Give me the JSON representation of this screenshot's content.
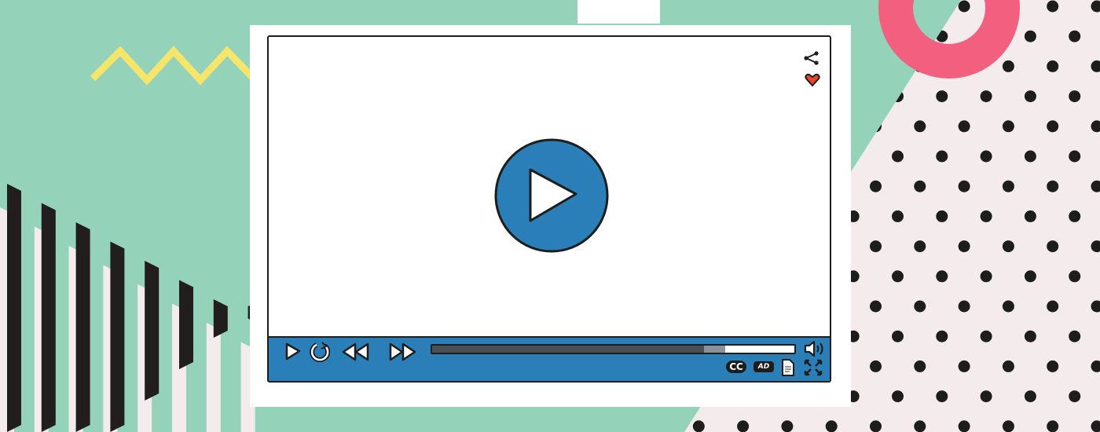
{
  "colors": {
    "background_green": "#94d3b9",
    "pattern_pink": "#f4ecec",
    "ring_pink": "#f25f7f",
    "zigzag_yellow": "#f5e56b",
    "player_blue": "#2b7fb8",
    "heart_red": "#e8452c"
  },
  "player": {
    "center_icon": "play-icon",
    "top_icons": [
      "share-icon",
      "heart-icon"
    ],
    "controls": [
      "play-icon",
      "replay-icon",
      "rewind-icon",
      "fast-forward-icon"
    ],
    "progress": {
      "played_fraction": 0.75,
      "buffered_fraction": 0.81
    },
    "right_icons": [
      "volume-icon",
      "transcript-icon",
      "fullscreen-icon"
    ],
    "cc_label": "CC",
    "ad_label": "AD"
  }
}
